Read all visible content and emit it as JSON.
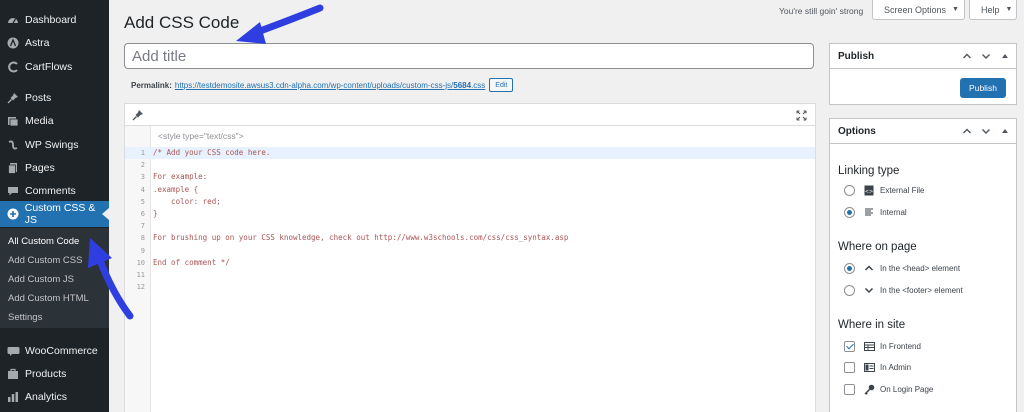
{
  "sidebar": {
    "items": [
      {
        "label": "Dashboard",
        "icon": "dashboard-icon"
      },
      {
        "label": "Astra",
        "icon": "astra-icon"
      },
      {
        "label": "CartFlows",
        "icon": "cartflows-icon"
      },
      {
        "label": "Posts",
        "icon": "pin-icon"
      },
      {
        "label": "Media",
        "icon": "media-icon"
      },
      {
        "label": "WP Swings",
        "icon": "wpswings-icon"
      },
      {
        "label": "Pages",
        "icon": "pages-icon"
      },
      {
        "label": "Comments",
        "icon": "comments-icon"
      },
      {
        "label": "Custom CSS & JS",
        "icon": "plus-circle-icon"
      },
      {
        "label": "WooCommerce",
        "icon": "woocommerce-icon"
      },
      {
        "label": "Products",
        "icon": "products-icon"
      },
      {
        "label": "Analytics",
        "icon": "analytics-icon"
      }
    ],
    "submenu": [
      "All Custom Code",
      "Add Custom CSS",
      "Add Custom JS",
      "Add Custom HTML",
      "Settings"
    ]
  },
  "header": {
    "status_text": "You're still goin' strong",
    "screen_options": "Screen Options",
    "help": "Help"
  },
  "page": {
    "title": "Add CSS Code",
    "title_placeholder": "Add title"
  },
  "permalink": {
    "label": "Permalink:",
    "url_prefix": "https://testdemosite.awsus3.cdn-alpha.com/wp-content/uploads/custom-css-js/",
    "url_slug": "5684",
    "url_ext": ".css",
    "edit": "Edit"
  },
  "editor": {
    "style_tag": "<style type=\"text/css\">",
    "line_numbers": [
      "1",
      "2",
      "3",
      "4",
      "5",
      "6",
      "7",
      "8",
      "9",
      "10",
      "11",
      "12"
    ],
    "lines": [
      "/* Add your CSS code here.",
      "",
      "For example:",
      ".example {",
      "    color: red;",
      "}",
      "",
      "For brushing up on your CSS knowledge, check out http://www.w3schools.com/css/css_syntax.asp",
      "",
      "End of comment */",
      "",
      ""
    ]
  },
  "publish_box": {
    "title": "Publish",
    "button": "Publish"
  },
  "options_box": {
    "title": "Options",
    "linking_type": {
      "heading": "Linking type",
      "options": [
        {
          "label": "External File",
          "checked": false
        },
        {
          "label": "Internal",
          "checked": true
        }
      ]
    },
    "where_on_page": {
      "heading": "Where on page",
      "options": [
        {
          "label": "In the <head> element",
          "checked": true
        },
        {
          "label": "In the <footer> element",
          "checked": false
        }
      ]
    },
    "where_in_site": {
      "heading": "Where in site",
      "options": [
        {
          "label": "In Frontend",
          "checked": true
        },
        {
          "label": "In Admin",
          "checked": false
        },
        {
          "label": "On Login Page",
          "checked": false
        }
      ]
    }
  },
  "colors": {
    "accent": "#2271b1",
    "annotation_arrow": "#2f3ee0",
    "sidebar_bg": "#1d2327"
  }
}
